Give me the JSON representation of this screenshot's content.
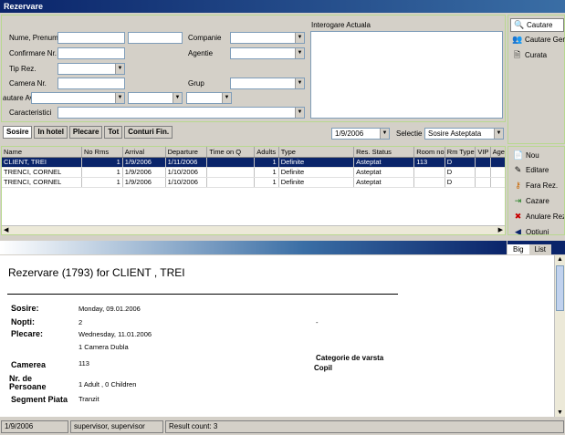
{
  "window": {
    "title": "Rezervare"
  },
  "search": {
    "fields": {
      "nume_label": "Nume, Prenume",
      "confirmare_label": "Confirmare Nr.",
      "tip_label": "Tip Rez.",
      "camera_label": "Camera Nr.",
      "cautare_avn_label": "autare Avn.",
      "caracteristici_label": "Caracteristici",
      "companie_label": "Companie",
      "agentie_label": "Agentie",
      "grup_label": "Grup"
    },
    "interogare_label": "Interogare Actuala"
  },
  "side_actions": [
    {
      "label": "Cautare",
      "icon": "search-icon"
    },
    {
      "label": "Cautare Gen",
      "icon": "people-search-icon"
    },
    {
      "label": "Curata",
      "icon": "clear-icon"
    }
  ],
  "tabs": [
    "Sosire",
    "In hotel",
    "Plecare",
    "Tot",
    "Conturi Fin."
  ],
  "filters": {
    "date": "1/9/2006",
    "selectie_label": "Selectie",
    "selectie_value": "Sosire Asteptata"
  },
  "grid": {
    "columns": [
      "Name",
      "No Rms",
      "Arrival",
      "Departure",
      "Time on Q",
      "Adults",
      "Type",
      "Res. Status",
      "Room no",
      "Rm Type",
      "VIP",
      "Agent"
    ],
    "rows": [
      [
        "CLIENT, TREI",
        "1",
        "1/9/2006",
        "1/11/2006",
        "",
        "1",
        "Definite",
        "Asteptat",
        "113",
        "D",
        "",
        ""
      ],
      [
        "TRENCI, CORNEL",
        "1",
        "1/9/2006",
        "1/10/2006",
        "",
        "1",
        "Definite",
        "Asteptat",
        "",
        "D",
        "",
        ""
      ],
      [
        "TRENCI, CORNEL",
        "1",
        "1/9/2006",
        "1/10/2006",
        "",
        "1",
        "Definite",
        "Asteptat",
        "",
        "D",
        "",
        ""
      ]
    ]
  },
  "row_actions": [
    {
      "label": "Nou",
      "icon": "new-icon"
    },
    {
      "label": "Editare",
      "icon": "edit-icon"
    },
    {
      "label": "Fara Rez.",
      "icon": "key-icon"
    },
    {
      "label": "Cazare",
      "icon": "checkin-icon"
    },
    {
      "label": "Anulare Rez",
      "icon": "cancel-icon"
    },
    {
      "label": "Optiuni",
      "icon": "options-icon"
    }
  ],
  "view_tabs": [
    "Big",
    "List"
  ],
  "document": {
    "heading": "Rezervare (1793) for CLIENT , TREI",
    "sosire_label": "Sosire:",
    "sosire_value": "Monday, 09.01.2006",
    "nopti_label": "Nopti:",
    "nopti_value": "2",
    "nopti_extra": "-",
    "plecare_label": "Plecare:",
    "plecare_value": "Wednesday, 11.01.2006",
    "camera_dubla": "1 Camera Dubla",
    "camerea_label": "Camerea",
    "camerea_value": "113",
    "categorie_label": "Categorie de varsta",
    "copil_label": "Copil",
    "persoane_label": "Nr. de Persoane",
    "persoane_value": "1 Adult , 0 Children",
    "segment_label": "Segment Piata",
    "segment_value": "Tranzit"
  },
  "status": {
    "date": "1/9/2006",
    "user": "supervisor, supervisor",
    "result": "Result count: 3"
  },
  "colors": {
    "selection": "#0a246a",
    "accent_green": "#c8e6a0",
    "titlebar": "#0a246a"
  }
}
